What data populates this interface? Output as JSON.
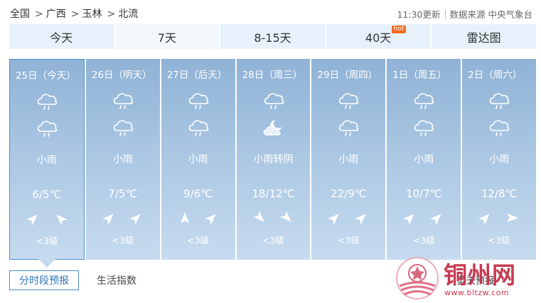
{
  "breadcrumb": {
    "items": [
      "全国",
      "广西",
      "玉林",
      "北流"
    ],
    "separator": ">"
  },
  "meta": {
    "update_time": "11:30更新",
    "source": "数据来源 中央气象台"
  },
  "tabs": [
    {
      "label": "今天",
      "active": false
    },
    {
      "label": "7天",
      "active": true
    },
    {
      "label": "8-15天",
      "active": false
    },
    {
      "label": "40天",
      "active": false,
      "badge": "hot"
    },
    {
      "label": "雷达图",
      "active": false
    }
  ],
  "days": [
    {
      "date": "25日（今天）",
      "icon_day": "light-rain-icon",
      "icon_night": "light-rain-icon",
      "condition": "小雨",
      "temp": "6/5℃",
      "wind": [
        "northeast",
        "northwest"
      ],
      "level": "<3级",
      "today": true
    },
    {
      "date": "26日（明天）",
      "icon_day": "light-rain-icon",
      "icon_night": "light-rain-icon",
      "condition": "小雨",
      "temp": "7/5℃",
      "wind": [
        "northeast",
        "northeast"
      ],
      "level": "<3级",
      "today": false
    },
    {
      "date": "27日（后天）",
      "icon_day": "light-rain-icon",
      "icon_night": "light-rain-icon",
      "condition": "小雨",
      "temp": "9/6℃",
      "wind": [
        "north",
        "northeast"
      ],
      "level": "<3级",
      "today": false
    },
    {
      "date": "28日（周三）",
      "icon_day": "light-rain-icon",
      "icon_night": "cloudy-night-icon",
      "condition": "小雨转阴",
      "temp": "18/12℃",
      "wind": [
        "southeast",
        "southeast"
      ],
      "level": "<3级",
      "today": false
    },
    {
      "date": "29日（周四）",
      "icon_day": "light-rain-icon",
      "icon_night": "light-rain-icon",
      "condition": "小雨",
      "temp": "22/9℃",
      "wind": [
        "northeast",
        "northeast"
      ],
      "level": "<3级",
      "today": false
    },
    {
      "date": "1日（周五）",
      "icon_day": "light-rain-icon",
      "icon_night": "light-rain-icon",
      "condition": "小雨",
      "temp": "10/7℃",
      "wind": [
        "northeast",
        "northeast"
      ],
      "level": "<3级",
      "today": false
    },
    {
      "date": "2日（周六）",
      "icon_day": "light-rain-icon",
      "icon_night": "light-rain-icon",
      "condition": "小雨",
      "temp": "12/8℃",
      "wind": [
        "northeast",
        "east"
      ],
      "level": "<3级",
      "today": false
    }
  ],
  "subtabs": {
    "hourly": "分时段预报",
    "life": "生活指数",
    "extra": "蓝天预报"
  },
  "watermark": {
    "title": "铜州网",
    "url": "www.bltzw.com"
  },
  "colors": {
    "card_top": "#8fb2d6",
    "card_bottom": "#c6dbef",
    "tab_bg": "#e6f1fb",
    "accent": "#4e8fc7",
    "hot": "#f26b1d",
    "watermark": "#c73a52"
  }
}
